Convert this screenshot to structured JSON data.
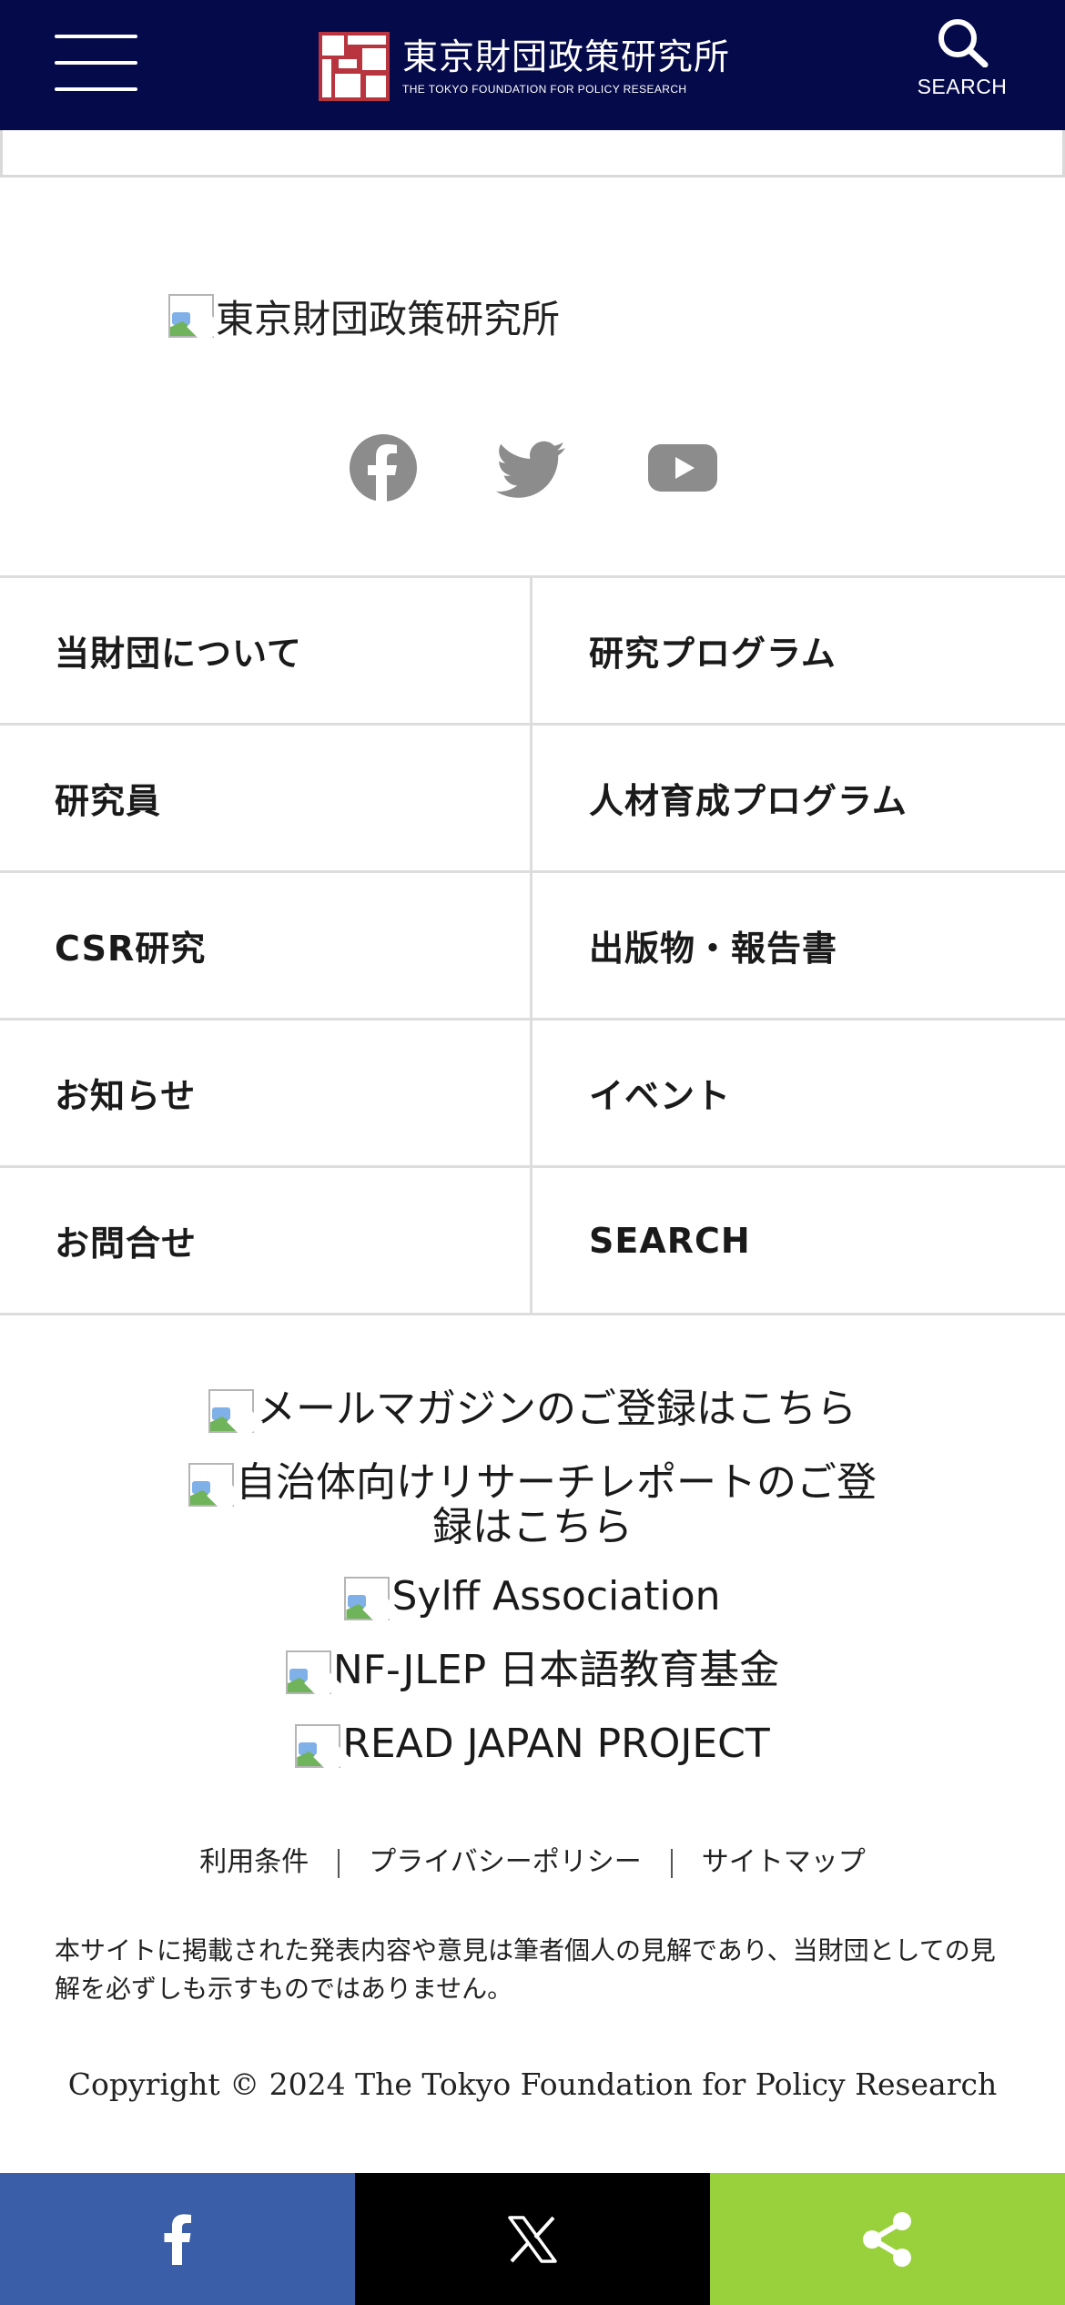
{
  "header": {
    "logo_jp": "東京財団政策研究所",
    "logo_en": "THE TOKYO FOUNDATION FOR POLICY RESEARCH",
    "search_label": "SEARCH",
    "background": "#050a4a"
  },
  "footer": {
    "brand_alt": "東京財団政策研究所",
    "social": [
      {
        "name": "facebook",
        "icon": "facebook-icon"
      },
      {
        "name": "twitter",
        "icon": "twitter-icon"
      },
      {
        "name": "youtube",
        "icon": "youtube-icon"
      }
    ],
    "nav": [
      {
        "label": "当財団について"
      },
      {
        "label": "研究プログラム"
      },
      {
        "label": "研究員"
      },
      {
        "label": "人材育成プログラム"
      },
      {
        "label": "CSR研究"
      },
      {
        "label": "出版物・報告書"
      },
      {
        "label": "お知らせ"
      },
      {
        "label": "イベント"
      },
      {
        "label": "お問合せ"
      },
      {
        "label": "SEARCH"
      }
    ],
    "banners": [
      {
        "label": "メールマガジンのご登録はこちら"
      },
      {
        "label": "自治体向けリサーチレポートのご登録はこちら"
      },
      {
        "label": "Sylff Association"
      },
      {
        "label": "NF-JLEP 日本語教育基金"
      },
      {
        "label": "READ JAPAN PROJECT"
      }
    ],
    "links": [
      {
        "label": "利用条件"
      },
      {
        "label": "プライバシーポリシー"
      },
      {
        "label": "サイトマップ"
      }
    ],
    "disclaimer": "本サイトに掲載された発表内容や意見は筆者個人の見解であり、当財団としての見解を必ずしも示すものではありません。",
    "copyright": "Copyright © 2024 The Tokyo Foundation for Policy Research"
  },
  "share_bar": {
    "buttons": [
      {
        "name": "facebook",
        "icon": "facebook-f-icon",
        "color": "#3b5ea8"
      },
      {
        "name": "x",
        "icon": "x-logo-icon",
        "color": "#000000"
      },
      {
        "name": "share",
        "icon": "share-icon",
        "color": "#99d13c"
      }
    ]
  }
}
